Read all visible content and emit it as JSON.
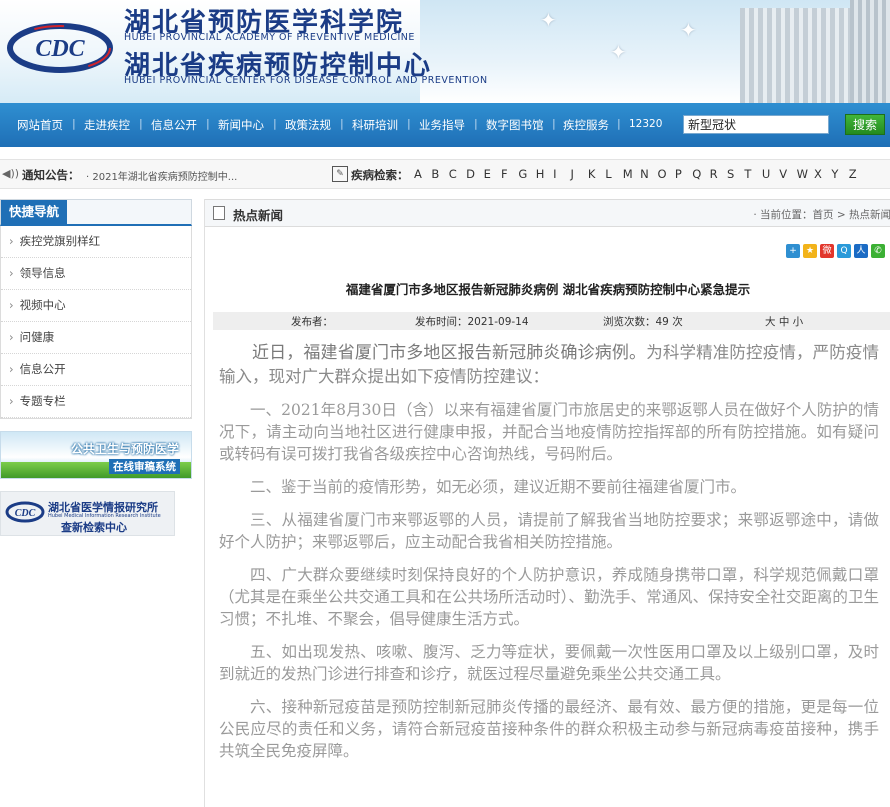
{
  "header": {
    "title_cn_1": "湖北省预防医学科学院",
    "title_en_1": "HUBEI PROVINCIAL ACADEMY OF PREVENTIVE MEDICINE",
    "title_cn_2": "湖北省疾病预防控制中心",
    "title_en_2": "HUBEI PROVINCIAL CENTER FOR DISEASE CONTROL AND PREVENTION",
    "logo_text": "CDC"
  },
  "nav": {
    "items": [
      "网站首页",
      "走进疾控",
      "信息公开",
      "新闻中心",
      "政策法规",
      "科研培训",
      "业务指导",
      "数字图书馆",
      "疾控服务",
      "12320"
    ],
    "search_value": "新型冠状",
    "search_button": "搜索"
  },
  "notice": {
    "label": "通知公告：",
    "text": "· 2021年湖北省疾病预防控制中...",
    "disease_search_label": "疾病检索：",
    "letters": [
      "A",
      "B",
      "C",
      "D",
      "E",
      "F",
      "G",
      "H",
      "I",
      "J",
      "K",
      "L",
      "M",
      "N",
      "O",
      "P",
      "Q",
      "R",
      "S",
      "T",
      "U",
      "V",
      "W",
      "X",
      "Y",
      "Z"
    ]
  },
  "sidebar": {
    "title": "快捷导航",
    "items": [
      "疾控党旗别样红",
      "领导信息",
      "视频中心",
      "问健康",
      "信息公开",
      "专题专栏"
    ],
    "banner1_line1": "公共卫生与预防医学",
    "banner1_line2": "在线审稿系统",
    "banner2_name": "湖北省医学情报研究所",
    "banner2_en": "Hubei Medical Information Research Institute",
    "banner2_sub": "查新检索中心"
  },
  "main": {
    "section_title": "热点新闻",
    "breadcrumb": "· 当前位置：首页 > 热点新闻",
    "article_title": "福建省厦门市多地区报告新冠肺炎病例 湖北省疾病预防控制中心紧急提示",
    "meta": {
      "publisher": "发布者：",
      "date": "发布时间：2021-09-14",
      "views": "浏览次数：49 次",
      "font_size": "大 中 小"
    },
    "lead_bold": "近日，福建省厦门市多地区报告新冠肺炎确诊病例。",
    "lead_rest": "为科学精准防控疫情，严防疫情输入，现对广大群众提出如下疫情防控建议：",
    "paragraphs": [
      "一、2021年8月30日（含）以来有福建省厦门市旅居史的来鄂返鄂人员在做好个人防护的情况下，请主动向当地社区进行健康申报，并配合当地疫情防控指挥部的所有防控措施。如有疑问或转码有误可拨打我省各级疾控中心咨询热线，号码附后。",
      "二、鉴于当前的疫情形势，如无必须，建议近期不要前往福建省厦门市。",
      "三、从福建省厦门市来鄂返鄂的人员，请提前了解我省当地防控要求；来鄂返鄂途中，请做好个人防护；来鄂返鄂后，应主动配合我省相关防控措施。",
      "四、广大群众要继续时刻保持良好的个人防护意识，养成随身携带口罩，科学规范佩戴口罩（尤其是在乘坐公共交通工具和在公共场所活动时）、勤洗手、常通风、保持安全社交距离的卫生习惯；不扎堆、不聚会，倡导健康生活方式。",
      "五、如出现发热、咳嗽、腹泻、乏力等症状，要佩戴一次性医用口罩及以上级别口罩，及时到就近的发热门诊进行排查和诊疗，就医过程尽量避免乘坐公共交通工具。",
      "六、接种新冠疫苗是预防控制新冠肺炎传播的最经济、最有效、最方便的措施，更是每一位公民应尽的责任和义务，请符合新冠疫苗接种条件的群众积极主动参与新冠病毒疫苗接种，携手共筑全民免疫屏障。"
    ],
    "share_icons": [
      "plus-icon",
      "qzone-icon",
      "weibo-icon",
      "qq-icon",
      "renren-icon",
      "wechat-icon"
    ],
    "share_colors": [
      "#2f8fd1",
      "#f2b31a",
      "#e2362c",
      "#2a9ad9",
      "#1b6bc4",
      "#3cb034"
    ]
  }
}
